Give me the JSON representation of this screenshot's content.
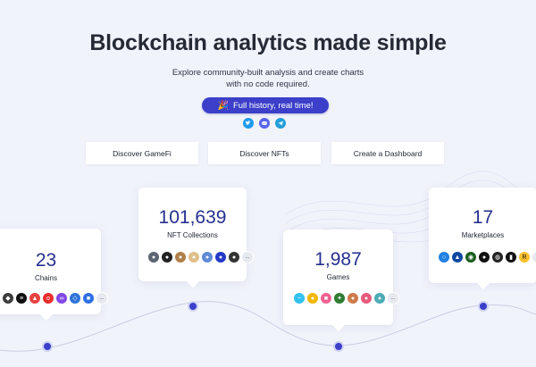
{
  "hero": {
    "title": "Blockchain analytics made simple",
    "subtitle": "Explore community-built analysis and create charts with no code required.",
    "pill_label": "Full history, real time!"
  },
  "socials": [
    "twitter-icon",
    "discord-icon",
    "telegram-icon"
  ],
  "discover_buttons": [
    {
      "label": "Discover GameFi"
    },
    {
      "label": "Discover NFTs"
    },
    {
      "label": "Create a Dashboard"
    }
  ],
  "stats": {
    "chains": {
      "value": "23",
      "label": "Chains",
      "more": "..."
    },
    "nft_collections": {
      "value": "101,639",
      "label": "NFT Collections",
      "more": "..."
    },
    "games": {
      "value": "1,987",
      "label": "Games",
      "more": "..."
    },
    "marketplaces": {
      "value": "17",
      "label": "Marketplaces",
      "more": "..."
    }
  },
  "colors": {
    "accent": "#3b3fc9",
    "number": "#25308f",
    "background": "#f1f3fb"
  }
}
